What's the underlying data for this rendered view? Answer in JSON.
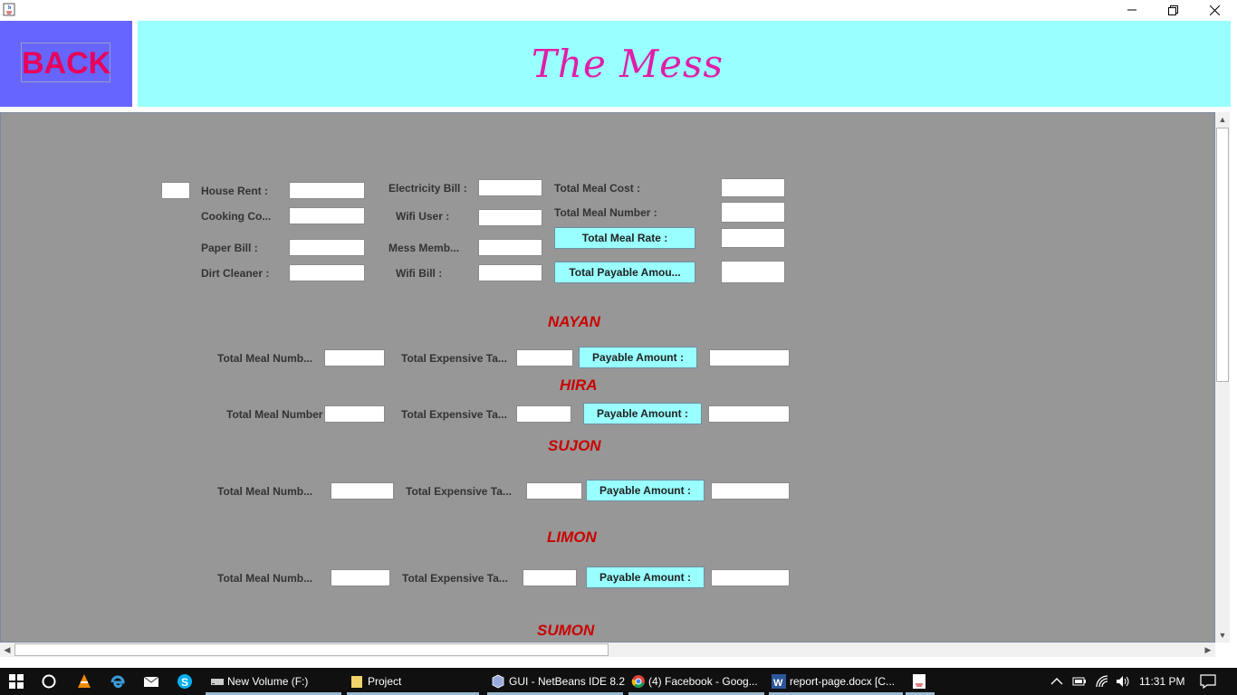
{
  "window": {
    "minimize_icon": "minimize-icon",
    "maximize_icon": "restore-icon",
    "close_icon": "close-icon"
  },
  "header": {
    "back_label": "BACK",
    "title": "The Mess"
  },
  "summary": {
    "house_rent": "House Rent :",
    "cooking_cost": "Cooking Co...",
    "paper_bill": "Paper Bill :",
    "dirt_cleaner": "Dirt Cleaner :",
    "electricity_bill": "Electricity Bill :",
    "wifi_user": "Wifi User :",
    "mess_members": "Mess Memb...",
    "wifi_bill": "Wifi Bill :",
    "total_meal_cost": "Total Meal Cost :",
    "total_meal_number": "Total Meal Number :",
    "total_meal_rate_button": "Total Meal Rate :",
    "total_payable_button": "Total Payable Amou..."
  },
  "members": [
    {
      "name": "NAYAN",
      "meal_label": "Total Meal Numb...",
      "expense_label": "Total Expensive Ta...",
      "payable_button": "Payable Amount :"
    },
    {
      "name": "HIRA",
      "meal_label": "Total Meal Number",
      "expense_label": "Total Expensive Ta...",
      "payable_button": "Payable Amount :"
    },
    {
      "name": "SUJON",
      "meal_label": "Total Meal Numb...",
      "expense_label": "Total Expensive Ta...",
      "payable_button": "Payable Amount :"
    },
    {
      "name": "LIMON",
      "meal_label": "Total Meal Numb...",
      "expense_label": "Total Expensive Ta...",
      "payable_button": "Payable Amount :"
    },
    {
      "name": "SUMON"
    }
  ],
  "taskbar": {
    "items": [
      {
        "label": "New Volume (F:)",
        "icon": "drive-icon"
      },
      {
        "label": "Project",
        "icon": "folder-icon"
      },
      {
        "label": "GUI - NetBeans IDE 8.2",
        "icon": "netbeans-icon"
      },
      {
        "label": "(4) Facebook - Goog...",
        "icon": "chrome-icon"
      },
      {
        "label": "report-page.docx [C...",
        "icon": "word-icon"
      }
    ],
    "clock": "11:31 PM"
  }
}
